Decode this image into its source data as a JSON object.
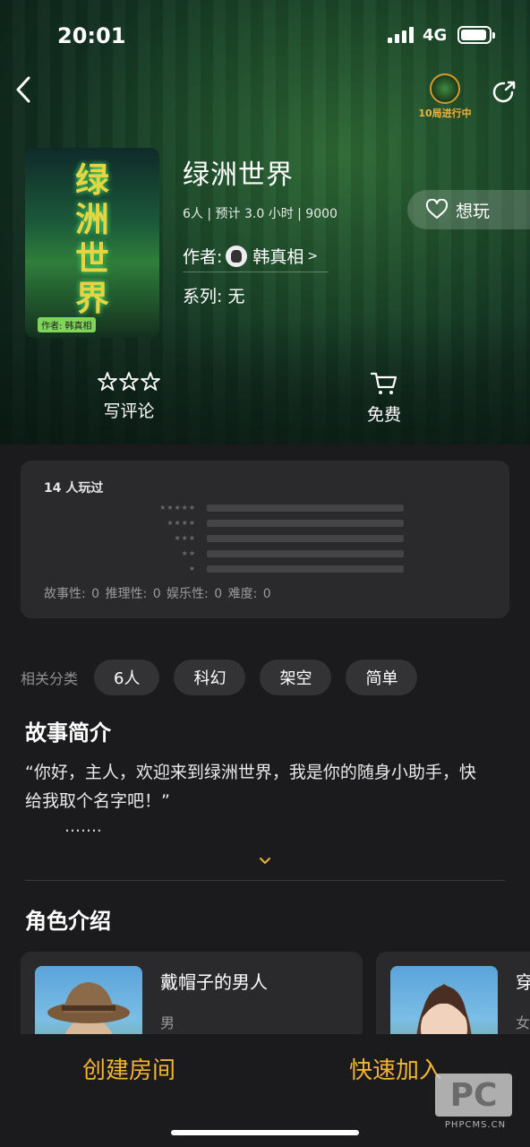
{
  "status": {
    "time": "20:01",
    "network": "4G"
  },
  "header": {
    "live_label": "10局进行中"
  },
  "game": {
    "title": "绿洲世界",
    "meta": "6人 | 预计 3.0 小时 | 9000",
    "author_label": "作者:",
    "author_name": "韩真相",
    "series_label": "系列: 无",
    "cover_title": "绿洲世界",
    "cover_tag": "作者: 韩真相"
  },
  "want_button": {
    "label": "想玩"
  },
  "actions": {
    "review_label": "写评论",
    "price_label": "免费"
  },
  "rating": {
    "played": "14 人玩过",
    "star_rows": [
      "★★★★★",
      "★★★★",
      "★★★",
      "★★",
      "★"
    ],
    "dimensions": "故事性: 0  推理性: 0  娱乐性: 0  难度: 0"
  },
  "tags": {
    "label": "相关分类",
    "items": [
      "6人",
      "科幻",
      "架空",
      "简单"
    ]
  },
  "story": {
    "title": "故事简介",
    "text": "“你好，主人，欢迎来到绿洲世界，我是你的随身小助手，快给我取个名字吧！”",
    "more": "……."
  },
  "characters": {
    "title": "角色介绍",
    "items": [
      {
        "name": "戴帽子的男人",
        "gender": "男"
      },
      {
        "name": "穿",
        "gender": "女"
      }
    ]
  },
  "bottom": {
    "create_room": "创建房间",
    "quick_join": "快速加入"
  },
  "watermark": {
    "logo": "PC",
    "site": "PHPCMS.CN"
  },
  "colors": {
    "accent": "#f2b431",
    "background": "#1b1b1d",
    "card": "#2a2a2c"
  }
}
